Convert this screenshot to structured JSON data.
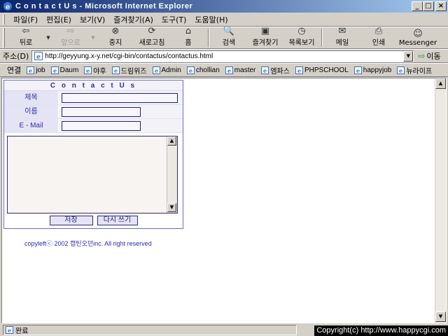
{
  "window": {
    "title": "C o n t a c t U s - Microsoft Internet Explorer",
    "buttons": [
      "_",
      "□",
      "×"
    ]
  },
  "menu": [
    "파일(F)",
    "편집(E)",
    "보기(V)",
    "즐겨찾기(A)",
    "도구(T)",
    "도움말(H)"
  ],
  "toolbar": {
    "back": "뒤로",
    "forward": "앞으로",
    "stop": "중지",
    "refresh": "새로고침",
    "home": "홈",
    "search": "검색",
    "favorites": "즐겨찾기",
    "history": "목록보기",
    "mail": "메일",
    "print": "인쇄",
    "messenger": "Messenger"
  },
  "address": {
    "label": "주소(D)",
    "url": "http://geyyung.x-y.net/cgi-bin/contactus/contactus.html",
    "go_label": "이동"
  },
  "links": {
    "label": "연결",
    "items": [
      "job",
      "Daum",
      "야후",
      "드림위즈",
      "Admin",
      "chollian",
      "master",
      "엠파스",
      "PHPSCHOOL",
      "happyjob",
      "뉴라이프"
    ]
  },
  "form": {
    "title": "C o n t a c t  U s",
    "subject_label": "제목",
    "name_label": "이름",
    "email_label": "E - Mail",
    "subject_value": "",
    "name_value": "",
    "email_value": "",
    "message_value": "",
    "save_label": "저장",
    "reset_label": "다시 쓰기"
  },
  "footer_text": "copyleftⓒ 2002 캡틴오던inc.  All right reserved",
  "status": {
    "text": "완료",
    "credit": "Copyright(c) http://www.happycgi.com"
  }
}
